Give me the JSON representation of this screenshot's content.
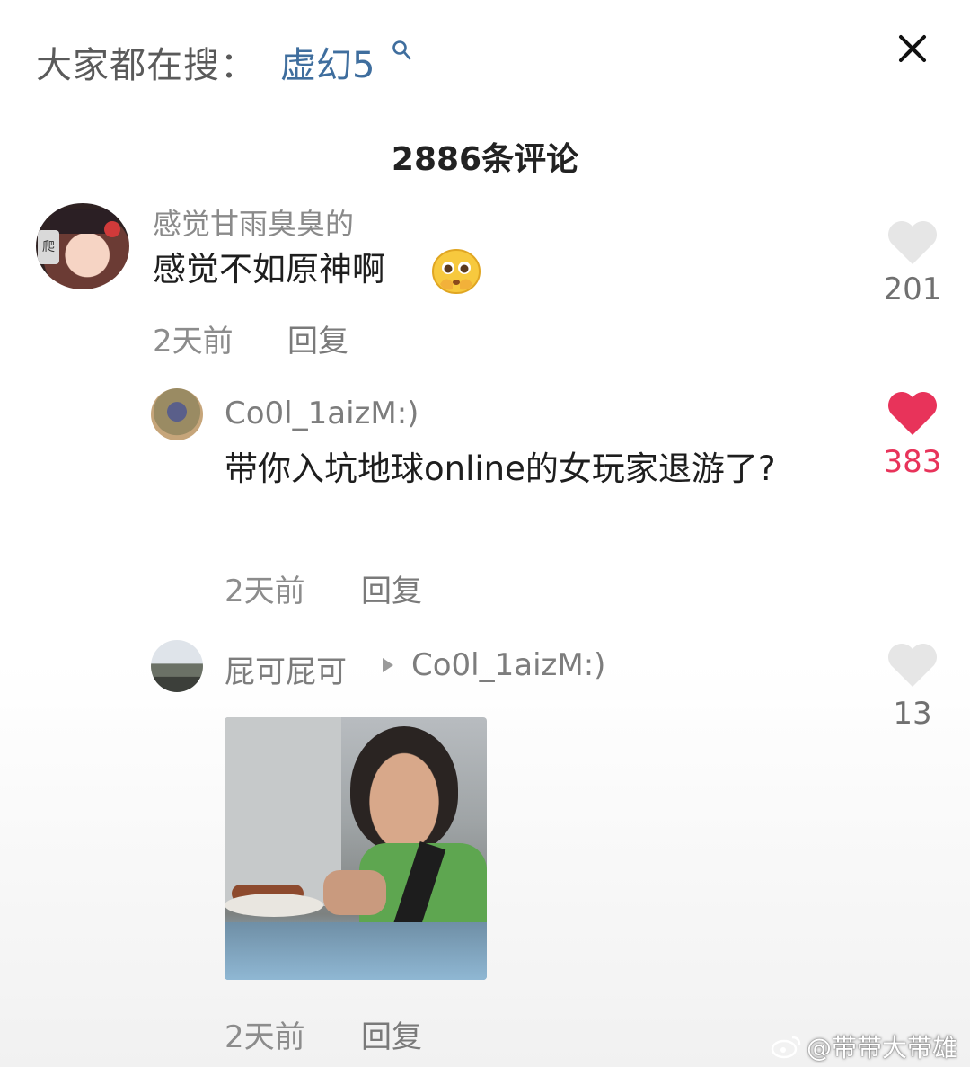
{
  "header": {
    "search_prefix": "大家都在搜：",
    "search_term": "虚幻5",
    "close_icon": "close-icon"
  },
  "comments_header": {
    "count_label": "2886条评论"
  },
  "comments": [
    {
      "username": "感觉甘雨臭臭的",
      "text": "感觉不如原神啊",
      "emoji": "pleading-face-emoji",
      "time": "2天前",
      "reply_label": "回复",
      "likes": "201",
      "liked": false
    },
    {
      "username": "Co0l_1aizM:)",
      "text": "带你入坑地球online的女玩家退游了?",
      "time": "2天前",
      "reply_label": "回复",
      "likes": "383",
      "liked": true
    },
    {
      "username": "屁可屁可",
      "reply_to": "Co0l_1aizM:)",
      "image": "photo-boy-smiling-at-phone",
      "time": "2天前",
      "reply_label": "回复",
      "likes": "13",
      "liked": false
    }
  ],
  "colors": {
    "accent_link": "#3f6e9e",
    "liked_red": "#e8335a",
    "heart_gray": "#e6e6e6"
  },
  "watermark": {
    "text": "@带带大带雄",
    "icon": "weibo-icon"
  }
}
